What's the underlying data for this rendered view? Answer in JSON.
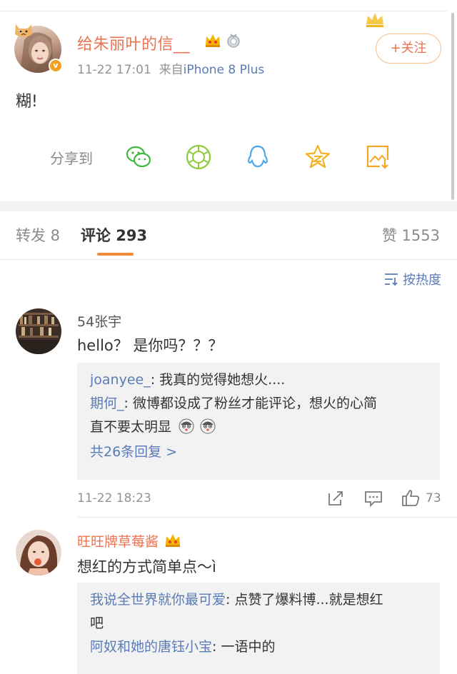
{
  "post": {
    "username": "给朱丽叶的信__",
    "time": "11-22 17:01",
    "source_prefix": "来自",
    "source": "iPhone 8 Plus",
    "follow_label": "+关注",
    "text": "糊!",
    "share_label": "分享到",
    "share_icons": [
      "wechat-icon",
      "moments-icon",
      "qq-icon",
      "qzone-icon",
      "save-image-icon"
    ]
  },
  "tabs": {
    "repost": "转发 8",
    "comments": "评论 293",
    "likes": "赞 1553"
  },
  "sort_label": "按热度",
  "comments": [
    {
      "name": "54张宇",
      "text": "hello？ 是你吗？？？",
      "replies": [
        {
          "name": "joanyee_",
          "text": ": 我真的觉得她想火...."
        },
        {
          "name": "期何_",
          "text": ": 微博都设成了粉丝才能评论，想火的心简"
        },
        {
          "name": "",
          "text": "直不要太明显"
        }
      ],
      "more": "共26条回复 >",
      "time": "11-22 18:23",
      "like_count": "73"
    },
    {
      "name": "旺旺牌草莓酱",
      "text": "想红的方式简单点～ì",
      "replies": [
        {
          "name": "我说全世界就你最可爱",
          "text": ": 点赞了爆料博...就是想红"
        },
        {
          "name": "",
          "text": "吧"
        },
        {
          "name": "阿奴和她的唐钰小宝",
          "text": ": 一语中的"
        }
      ]
    }
  ],
  "colors": {
    "accent_orange": "#eb7350",
    "link_blue": "#5a7bb7",
    "tab_underline": "#f08b3b",
    "follow_border": "#f6c08d"
  }
}
